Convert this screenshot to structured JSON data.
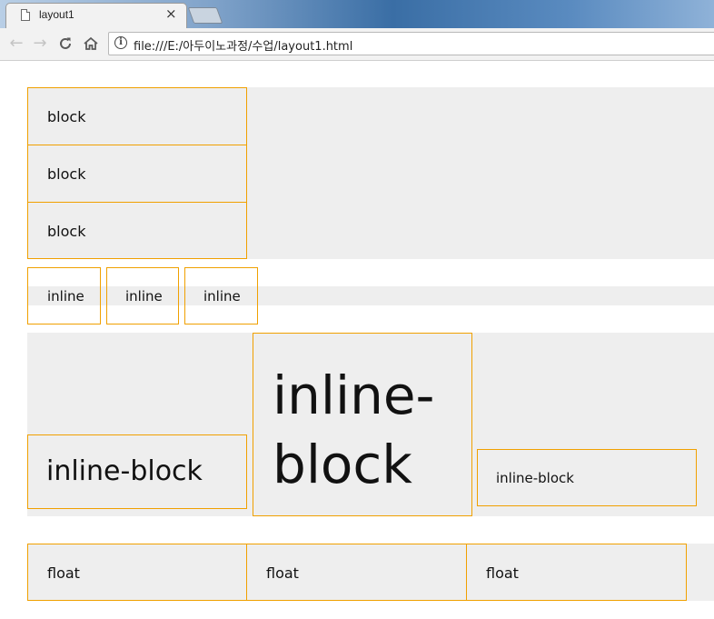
{
  "browser": {
    "tab_title": "layout1",
    "tab_close": "×",
    "url": "file:///E:/아두이노과정/수업/layout1.html",
    "info_glyph": "i"
  },
  "page": {
    "block_items": [
      "block",
      "block",
      "block"
    ],
    "inline_items": [
      "inline",
      "inline",
      "inline"
    ],
    "inline_block_items": [
      "inline-block",
      "inline-block",
      "inline-block"
    ],
    "inline_block_big_line1": "inline-",
    "inline_block_big_line2": "block",
    "float_items": [
      "float",
      "float",
      "float"
    ]
  },
  "colors": {
    "border": "#f0a000",
    "box_bg": "#eeeeee",
    "text": "#111111"
  }
}
